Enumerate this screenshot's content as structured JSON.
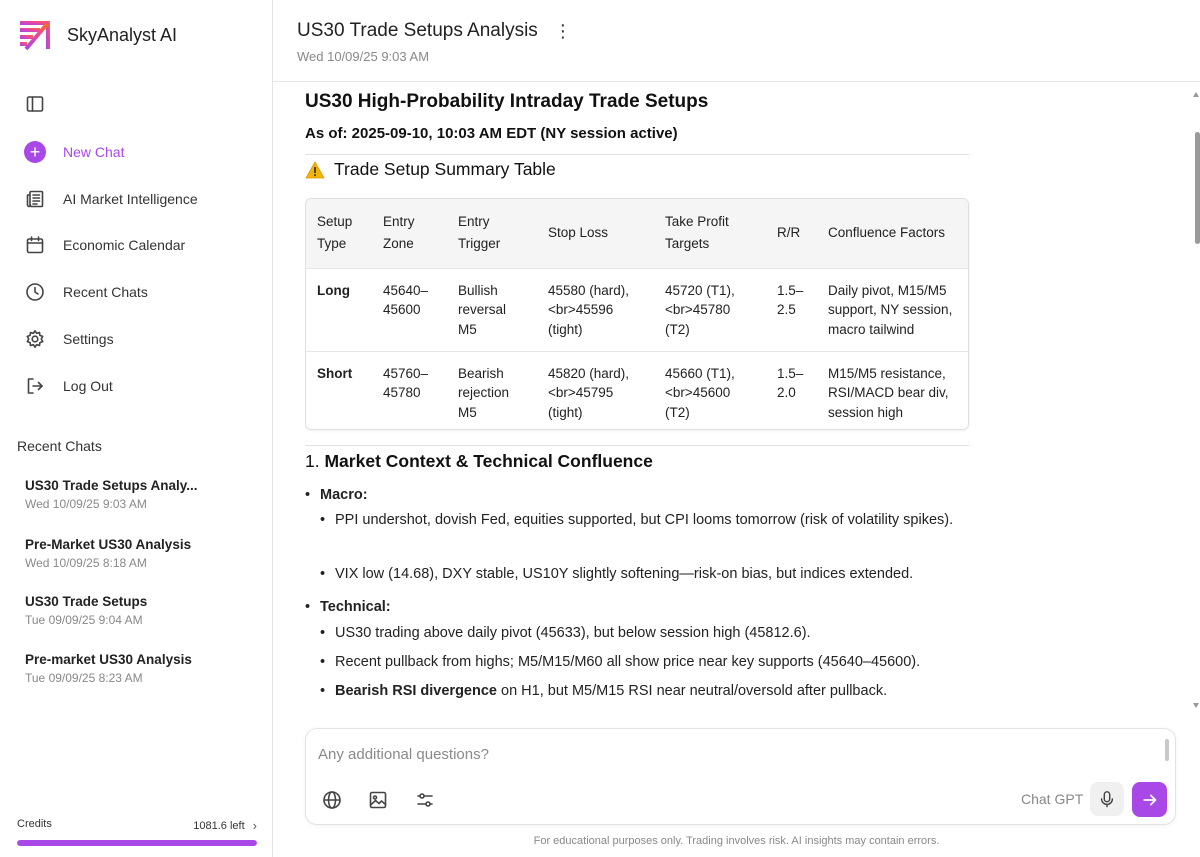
{
  "app": {
    "name": "SkyAnalyst AI",
    "accent": "#a848e6",
    "brand_color": "#f97316"
  },
  "sidebar": {
    "nav": [
      {
        "label": "",
        "icon": "sidebar-toggle-icon"
      },
      {
        "label": "New Chat",
        "icon": "plus-icon"
      },
      {
        "label": "AI Market Intelligence",
        "icon": "newspaper-icon"
      },
      {
        "label": "Economic Calendar",
        "icon": "calendar-icon"
      },
      {
        "label": "Recent Chats",
        "icon": "clock-icon"
      },
      {
        "label": "Settings",
        "icon": "gear-icon"
      },
      {
        "label": "Log Out",
        "icon": "logout-icon"
      }
    ],
    "recent_heading": "Recent Chats",
    "recent": [
      {
        "title": "US30 Trade Setups Analy...",
        "date": "Wed 10/09/25 9:03 AM"
      },
      {
        "title": "Pre-Market US30 Analysis",
        "date": "Wed 10/09/25 8:18 AM"
      },
      {
        "title": "US30 Trade Setups",
        "date": "Tue 09/09/25 9:04 AM"
      },
      {
        "title": "Pre-market US30 Analysis",
        "date": "Tue 09/09/25 8:23 AM"
      }
    ],
    "credits": {
      "label": "Credits",
      "left": "1081.6 left",
      "fill_fraction": 1.0
    }
  },
  "header": {
    "title": "US30 Trade Setups Analysis",
    "subtitle": "Wed 10/09/25 9:03 AM"
  },
  "content": {
    "heading": "US30 High-Probability Intraday Trade Setups",
    "as_of": "As of: 2025-09-10, 10:03 AM EDT (NY session active)",
    "summary_heading": "Trade Setup Summary Table",
    "table": {
      "headers": [
        [
          "Setup",
          "Type"
        ],
        [
          "Entry",
          "Zone"
        ],
        [
          "Entry",
          "Trigger"
        ],
        [
          "Stop Loss"
        ],
        [
          "Take Profit",
          "Targets"
        ],
        [
          "R/R"
        ],
        [
          "Confluence Factors"
        ]
      ],
      "rows": [
        [
          [
            "Long"
          ],
          [
            "45640–",
            "45600"
          ],
          [
            "Bullish",
            "reversal",
            "M5"
          ],
          [
            "45580 (hard),",
            "<br>45596",
            "(tight)"
          ],
          [
            "45720 (T1),",
            "<br>45780",
            "(T2)"
          ],
          [
            "1.5–",
            "2.5"
          ],
          [
            "Daily pivot, M15/M5",
            "support, NY session,",
            "macro tailwind"
          ]
        ],
        [
          [
            "Short"
          ],
          [
            "45760–",
            "45780"
          ],
          [
            "Bearish",
            "rejection",
            "M5"
          ],
          [
            "45820 (hard),",
            "<br>45795",
            "(tight)"
          ],
          [
            "45660 (T1),",
            "<br>45600",
            "(T2)"
          ],
          [
            "1.5–",
            "2.0"
          ],
          [
            "M15/M5 resistance,",
            "RSI/MACD bear div,",
            "session high"
          ]
        ]
      ]
    },
    "section1": {
      "number": "1.",
      "title": "Market Context & Technical Confluence",
      "groups": [
        {
          "label": "Macro:",
          "items": [
            "PPI undershot, dovish Fed, equities supported, but CPI looms tomorrow (risk of volatility spikes).",
            "VIX low (14.68), DXY stable, US10Y slightly softening—risk-on bias, but indices extended."
          ]
        },
        {
          "label": "Technical:",
          "items": [
            "US30 trading above daily pivot (45633), but below session high (45812.6).",
            "Recent pullback from highs; M5/M15/M60 all show price near key supports (45640–45600)."
          ],
          "last_bold": "Bearish RSI divergence",
          "last_rest": " on H1, but M5/M15 RSI near neutral/oversold after pullback."
        }
      ]
    }
  },
  "composer": {
    "placeholder": "Any additional questions?",
    "value": "",
    "model": "Chat GPT"
  },
  "disclaimer": "For educational purposes only. Trading involves risk. AI insights may contain errors."
}
